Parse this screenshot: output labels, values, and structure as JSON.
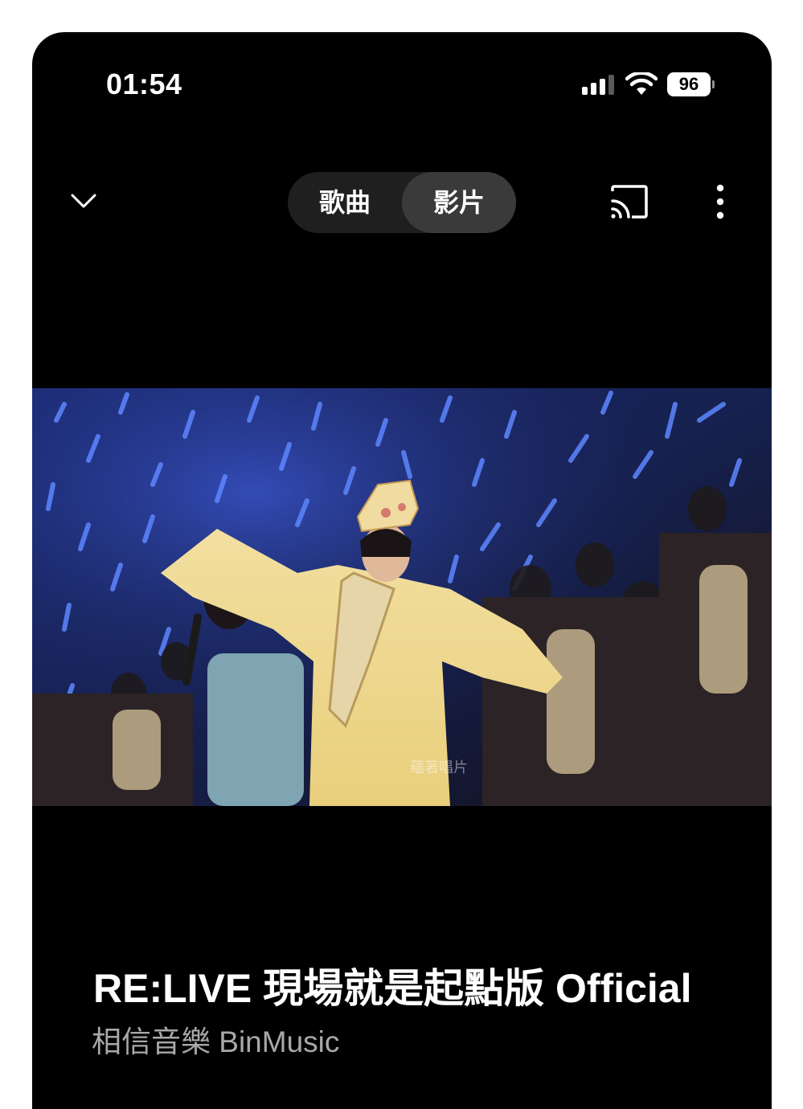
{
  "status_bar": {
    "time": "01:54",
    "battery_level": "96",
    "icons": [
      "signal-icon",
      "wifi-icon",
      "battery-icon"
    ]
  },
  "top_bar": {
    "collapse_icon": "chevron-down-icon",
    "tabs": [
      {
        "label": "歌曲",
        "selected": false
      },
      {
        "label": "影片",
        "selected": true
      }
    ],
    "cast_icon": "cast-icon",
    "more_icon": "more-vertical-icon"
  },
  "video": {
    "watermark": "蘊著唱片"
  },
  "now_playing": {
    "title": "RE:LIVE 現場就是起點版 Official",
    "artist": "相信音樂 BinMusic"
  },
  "colors": {
    "background": "#000000",
    "segment_bg": "#1f1f1f",
    "segment_selected": "#3a3a3a",
    "artist_text": "#a8a8a8"
  }
}
